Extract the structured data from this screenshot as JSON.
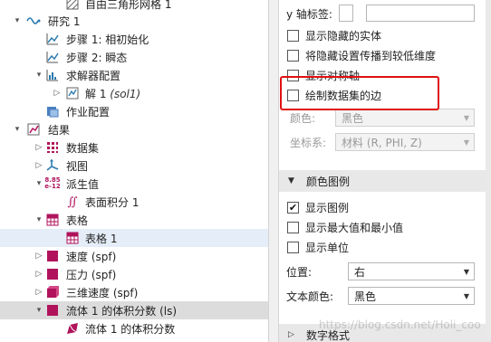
{
  "tree": {
    "geometry_item": "自由三角形网格 1",
    "study": "研究 1",
    "step1": "步骤 1: 相初始化",
    "step2": "步骤 2: 瞬态",
    "solver_config": "求解器配置",
    "solution": "解 1",
    "solution_tag": "(sol1)",
    "job_config": "作业配置",
    "results": "结果",
    "datasets": "数据集",
    "views": "视图",
    "derived_values": "派生值",
    "derived_icon_text": "8.85\ne-12",
    "surface_integration": "表面积分 1",
    "tables": "表格",
    "table1": "表格 1",
    "velocity": "速度 (spf)",
    "pressure": "压力 (spf)",
    "velocity3d": "三维速度 (spf)",
    "fluid_volume_fraction": "流体 1 的体积分数 (ls)",
    "fluid_volume_fraction_surface": "流体 1 的体积分数"
  },
  "settings": {
    "y_axis_label": "y 轴标签:",
    "y_axis_value": "",
    "show_hidden_entities": "显示隐藏的实体",
    "propagate_hiding": "将隐藏设置传播到较低维度",
    "show_symmetry_axis": "显示对称轴",
    "draw_dataset_edges": "绘制数据集的边",
    "color_label": "颜色:",
    "color_value": "黑色",
    "coord_system_label": "坐标系:",
    "coord_system_value": "材料 (R, PHI, Z)",
    "color_legend_section": "颜色图例",
    "show_legend": "显示图例",
    "show_legend_checked": true,
    "show_max_min": "显示最大值和最小值",
    "show_units": "显示单位",
    "position_label": "位置:",
    "position_value": "右",
    "text_color_label": "文本颜色:",
    "text_color_value": "黑色",
    "number_format_section": "数字格式"
  },
  "watermark": "https://blog.csdn.net/Holi_coo",
  "colors": {
    "highlight_blue": "#e5eef8",
    "highlight_gray": "#dcdcdc",
    "annotation_red": "#e01010",
    "plot_magenta": "#b0135c"
  }
}
